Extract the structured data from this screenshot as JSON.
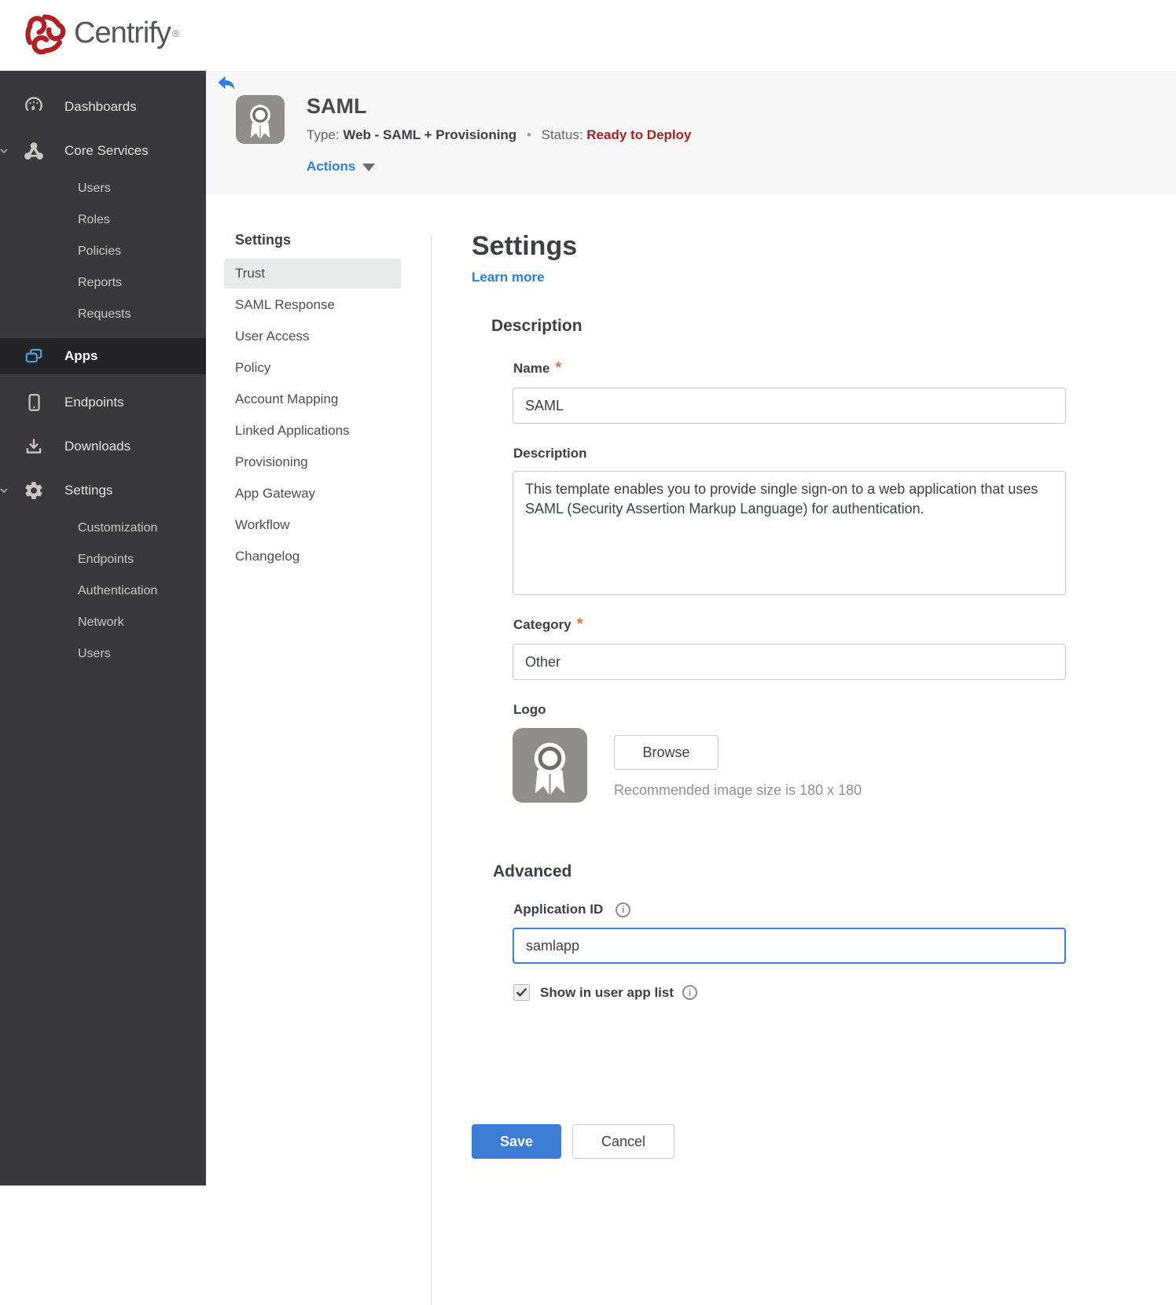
{
  "brand": {
    "name": "Centrify",
    "registered": "®",
    "logo_color": "#b01f24"
  },
  "sidebar": {
    "items": [
      {
        "label": "Dashboards"
      },
      {
        "label": "Core Services"
      },
      {
        "label": "Users"
      },
      {
        "label": "Roles"
      },
      {
        "label": "Policies"
      },
      {
        "label": "Reports"
      },
      {
        "label": "Requests"
      },
      {
        "label": "Apps"
      },
      {
        "label": "Endpoints"
      },
      {
        "label": "Downloads"
      },
      {
        "label": "Settings"
      },
      {
        "label": "Customization"
      },
      {
        "label": "Endpoints"
      },
      {
        "label": "Authentication"
      },
      {
        "label": "Network"
      },
      {
        "label": "Users"
      }
    ],
    "active_item": "Apps"
  },
  "header": {
    "title": "SAML",
    "type_label": "Type:",
    "type_value": "Web - SAML + Provisioning",
    "separator": "•",
    "status_label": "Status:",
    "status_value": "Ready to Deploy",
    "status_color": "#a32422",
    "actions_label": "Actions"
  },
  "subnav": {
    "header": "Settings",
    "active_item": "Trust",
    "items": [
      "Trust",
      "SAML Response",
      "User Access",
      "Policy",
      "Account Mapping",
      "Linked Applications",
      "Provisioning",
      "App Gateway",
      "Workflow",
      "Changelog"
    ]
  },
  "form": {
    "title": "Settings",
    "learn_more": "Learn more",
    "description_section": "Description",
    "required_marker": "*",
    "name_label": "Name",
    "name_value": "SAML",
    "description_label": "Description",
    "description_value": "This template enables you to provide single sign-on to a web application that uses SAML (Security Assertion Markup Language) for authentication.",
    "category_label": "Category",
    "category_value": "Other",
    "logo_label": "Logo",
    "browse_label": "Browse",
    "logo_hint": "Recommended image size is 180 x 180",
    "advanced_section": "Advanced",
    "application_id_label": "Application ID",
    "application_id_value": "samlapp",
    "show_in_app_list_label": "Show in user app list",
    "show_in_app_list_checked": true,
    "save_label": "Save",
    "cancel_label": "Cancel",
    "accent_blue": "#3b7cd5"
  }
}
